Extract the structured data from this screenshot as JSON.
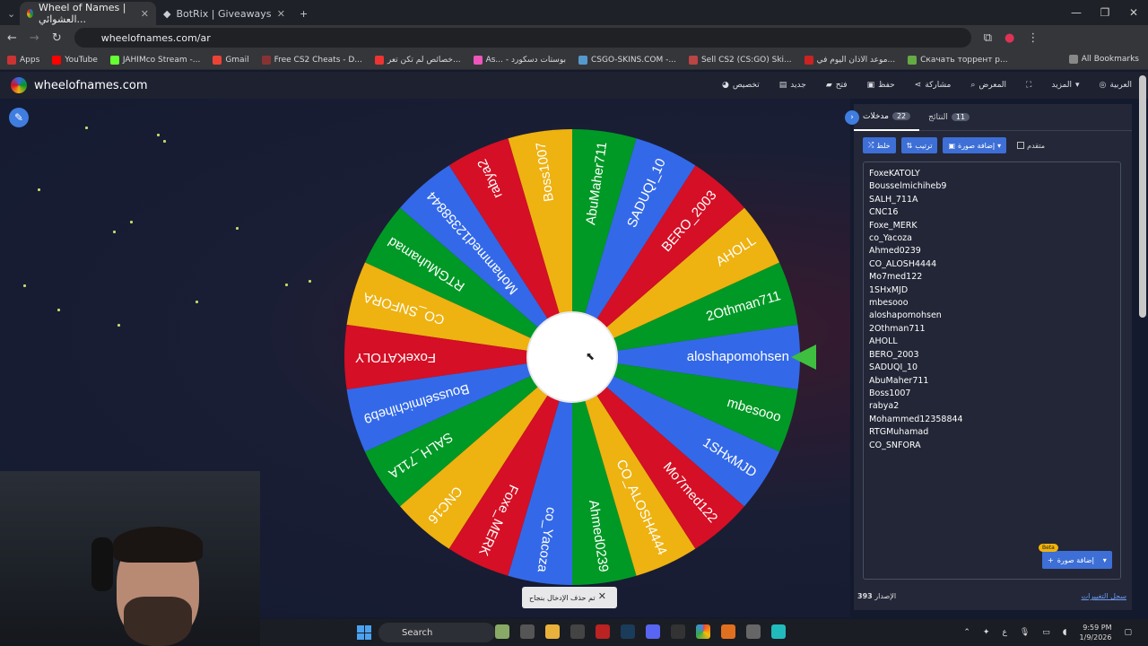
{
  "browser": {
    "tabs": [
      {
        "label": "Wheel of Names | العشوائي..."
      },
      {
        "label": "BotRix | Giveaways"
      }
    ],
    "url": "wheelofnames.com/ar",
    "bookmarks": [
      "Apps",
      "YouTube",
      "JAHIMco Stream -...",
      "Gmail",
      "Free CS2 Cheats - D...",
      "خصائص لم تكن تعر...",
      "As... - بوستات دسكورد",
      "CSGO-SKINS.COM -...",
      "Sell CS2 (CS:GO) Ski...",
      "موعد الاذان اليوم في...",
      "Скачать торрент р..."
    ],
    "all_bookmarks": "All Bookmarks"
  },
  "site": {
    "title": "wheelofnames.com",
    "menu": [
      "العربية",
      "المزيد",
      "المعرض",
      "مشاركة",
      "حفظ",
      "فتح",
      "جديد",
      "تخصيص"
    ]
  },
  "wheel": {
    "selected": "aloshapomohsen",
    "colors": [
      "#3369e8",
      "#009925",
      "#eeb211",
      "#d50f25"
    ],
    "segments": [
      "aloshapomohsen",
      "2Othman711",
      "AHOLL",
      "BERO_2003",
      "SADUQI_10",
      "AbuMaher711",
      "Boss1007",
      "rabya2",
      "Mohammed12358844",
      "RTGMuhamad",
      "CO_SNFORA",
      "FoxeKATOLY",
      "Bousselmichiheb9",
      "SALH_711A",
      "CNC16",
      "Foxe_MERK",
      "co_Yacoza",
      "Ahmed0239",
      "CO_ALOSH4444",
      "Mo7med122",
      "1SHxMJD",
      "mbesooo"
    ]
  },
  "toast": {
    "text": "تم حذف الإدخال بنجاح"
  },
  "panel": {
    "tab_entries": "مدخلات",
    "entries_count": "22",
    "tab_results": "النتائج",
    "results_count": "11",
    "shuffle": "خلط",
    "sort": "ترتيب",
    "add_image": "إضافة صورة",
    "advanced": "متقدم",
    "entries": [
      "FoxeKATOLY",
      "Bousselmichiheb9",
      "SALH_711A",
      "CNC16",
      "Foxe_MERK",
      "co_Yacoza",
      "Ahmed0239",
      "CO_ALOSH4444",
      "Mo7med122",
      "1SHxMJD",
      "mbesooo",
      "aloshapomohsen",
      "2Othman711",
      "AHOLL",
      "BERO_2003",
      "SADUQI_10",
      "AbuMaher711",
      "Boss1007",
      "rabya2",
      "Mohammed12358844",
      "RTGMuhamad",
      "CO_SNFORA"
    ],
    "add_image_btn": "إضافة صورة",
    "beta": "Beta",
    "version_label": "الإصدار",
    "version": "393",
    "changelog": "سجل التغييرات"
  },
  "taskbar": {
    "search": "Search",
    "time": "9:59 PM",
    "date": "1/9/2026"
  }
}
